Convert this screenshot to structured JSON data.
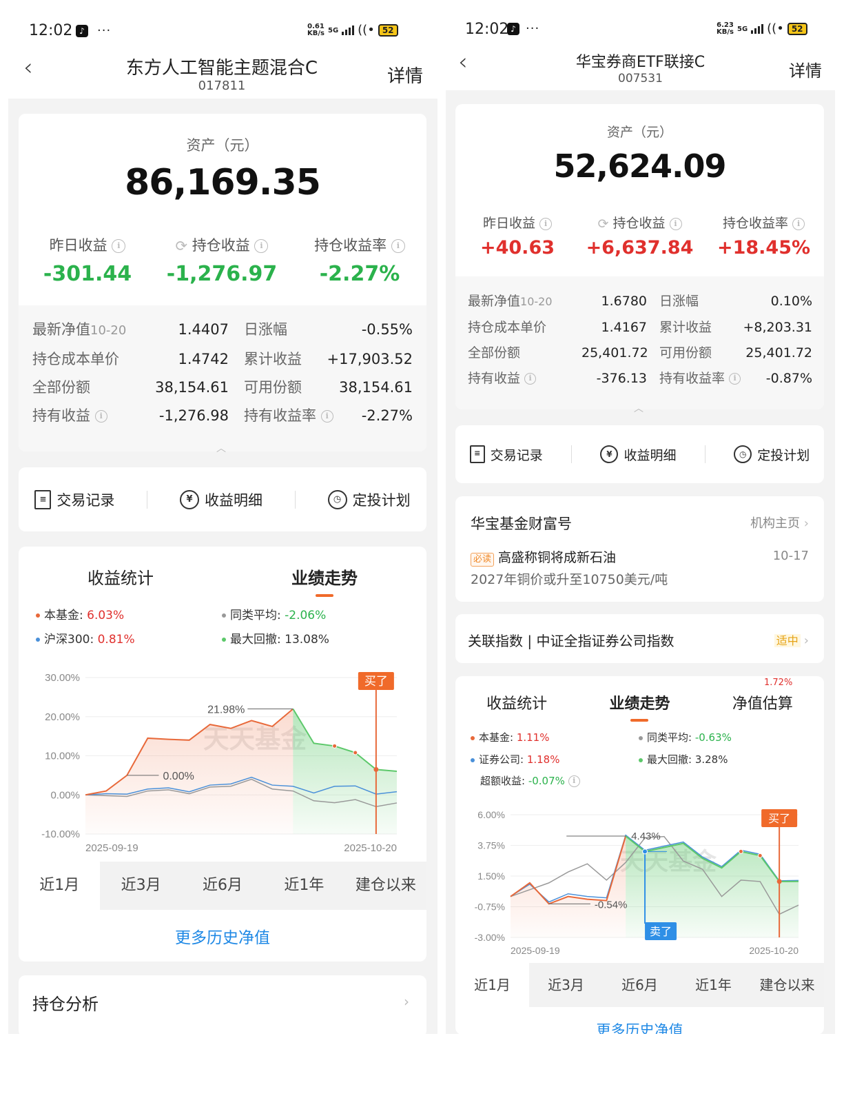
{
  "left": {
    "status": {
      "time": "12:02",
      "more": "···",
      "speed": "0.61\nKB/s",
      "net": "5G",
      "wifi": "((•",
      "battery": "52"
    },
    "header": {
      "back": "‹",
      "title": "东方人工智能主题混合C",
      "code": "017811",
      "detail": "详情"
    },
    "assets": {
      "label": "资产（元）",
      "value": "86,169.35",
      "metrics": [
        {
          "label": "昨日收益",
          "value": "-301.44"
        },
        {
          "label": "持仓收益",
          "value": "-1,276.97"
        },
        {
          "label": "持仓收益率",
          "value": "-2.27%"
        }
      ]
    },
    "details": {
      "nav_label": "最新净值",
      "nav_date": "10-20",
      "nav": "1.4407",
      "daily_label": "日涨幅",
      "daily": "-0.55%",
      "cost_label": "持仓成本单价",
      "cost": "1.4742",
      "cum_label": "累计收益",
      "cum": "+17,903.52",
      "shares_label": "全部份额",
      "shares": "38,154.61",
      "avail_label": "可用份额",
      "avail": "38,154.61",
      "hold_label": "持有收益",
      "hold": "-1,276.98",
      "hold_rate_label": "持有收益率",
      "hold_rate": "-2.27%"
    },
    "actions": [
      "交易记录",
      "收益明细",
      "定投计划"
    ],
    "tabs": [
      "收益统计",
      "业绩走势"
    ],
    "legend": {
      "fund": {
        "label": "本基金: ",
        "value": "6.03%"
      },
      "index": {
        "label": "沪深300: ",
        "value": "0.81%"
      },
      "peer": {
        "label": "同类平均: ",
        "value": "-2.06%"
      },
      "drawdown": {
        "label": "最大回撤: ",
        "value": "13.08%"
      }
    },
    "chart_data": {
      "type": "line",
      "x_start": "2025-09-19",
      "x_end": "2025-10-20",
      "ylim": [
        -10,
        30
      ],
      "yticks": [
        "30.00%",
        "20.00%",
        "10.00%",
        "0.00%",
        "-10.00%"
      ],
      "series": [
        {
          "name": "本基金",
          "color": "#e8693a",
          "values": [
            0,
            1,
            5,
            14.5,
            14.2,
            14,
            18,
            17,
            19,
            17.5,
            21.98,
            13.2,
            12.5,
            10.8,
            6.5,
            6.03
          ]
        },
        {
          "name": "沪深300",
          "color": "#4a90d9",
          "values": [
            0,
            0.3,
            0.2,
            1.5,
            1.8,
            0.8,
            2.5,
            2.8,
            4.5,
            2.5,
            2.2,
            0.5,
            2.2,
            2.3,
            0.2,
            0.81
          ]
        },
        {
          "name": "同类平均",
          "color": "#999999",
          "values": [
            0,
            -0.2,
            -0.4,
            1,
            1.3,
            0.3,
            2,
            2.2,
            4,
            1.5,
            1,
            -1.5,
            -2,
            -1.2,
            -3,
            -2.06
          ]
        }
      ],
      "annotations": {
        "max": "21.98%",
        "min": "0.00%",
        "buy": "买了"
      },
      "watermark": "天天基金"
    },
    "ranges": [
      "近1月",
      "近3月",
      "近6月",
      "近1年",
      "建仓以来"
    ],
    "more": "更多历史净值",
    "holdings": "持仓分析"
  },
  "right": {
    "status": {
      "time": "12:02",
      "more": "···",
      "speed": "6.23\nKB/s",
      "net": "5G",
      "wifi": "((•",
      "battery": "52"
    },
    "header": {
      "back": "‹",
      "title": "华宝券商ETF联接C",
      "code": "007531",
      "detail": "详情"
    },
    "assets": {
      "label": "资产（元）",
      "value": "52,624.09",
      "metrics": [
        {
          "label": "昨日收益",
          "value": "+40.63"
        },
        {
          "label": "持仓收益",
          "value": "+6,637.84"
        },
        {
          "label": "持仓收益率",
          "value": "+18.45%"
        }
      ]
    },
    "details": {
      "nav_label": "最新净值",
      "nav_date": "10-20",
      "nav": "1.6780",
      "daily_label": "日涨幅",
      "daily": "0.10%",
      "cost_label": "持仓成本单价",
      "cost": "1.4167",
      "cum_label": "累计收益",
      "cum": "+8,203.31",
      "shares_label": "全部份额",
      "shares": "25,401.72",
      "avail_label": "可用份额",
      "avail": "25,401.72",
      "hold_label": "持有收益",
      "hold": "-376.13",
      "hold_rate_label": "持有收益率",
      "hold_rate": "-0.87%"
    },
    "actions": [
      "交易记录",
      "收益明细",
      "定投计划"
    ],
    "news": {
      "source": "华宝基金财富号",
      "home": "机构主页",
      "badge": "必读",
      "headline": "高盛称铜将成新石油",
      "date": "10-17",
      "summary": "2027年铜价或升至10750美元/吨"
    },
    "index": {
      "label": "关联指数 | 中证全指证券公司指数",
      "rating": "适中"
    },
    "tabs": [
      "收益统计",
      "业绩走势",
      "净值估算"
    ],
    "estimate": "1.72%",
    "legend": {
      "fund": {
        "label": "本基金: ",
        "value": "1.11%"
      },
      "index": {
        "label": "证券公司: ",
        "value": "1.18%"
      },
      "excess": {
        "label": "超额收益: ",
        "value": "-0.07%"
      },
      "peer": {
        "label": "同类平均: ",
        "value": "-0.63%"
      },
      "drawdown": {
        "label": "最大回撤: ",
        "value": "3.28%"
      }
    },
    "chart_data": {
      "type": "line",
      "x_start": "2025-09-19",
      "x_end": "2025-10-20",
      "ylim": [
        -3,
        6
      ],
      "yticks": [
        "6.00%",
        "3.75%",
        "1.50%",
        "-0.75%",
        "-3.00%"
      ],
      "series": [
        {
          "name": "本基金",
          "color": "#e8693a",
          "values": [
            0,
            1,
            -0.54,
            0,
            -0.2,
            -0.3,
            4.43,
            3.3,
            3.6,
            3.9,
            2.8,
            2.1,
            3.3,
            3,
            1.1,
            1.11
          ]
        },
        {
          "name": "证券公司",
          "color": "#4a90d9",
          "values": [
            0,
            0.9,
            -0.4,
            0.2,
            0,
            -0.1,
            4.5,
            3.4,
            3.7,
            4,
            2.9,
            2.2,
            3.4,
            3.1,
            1.15,
            1.18
          ]
        },
        {
          "name": "同类平均",
          "color": "#999999",
          "values": [
            0,
            0.5,
            1,
            1.8,
            2.4,
            1.2,
            2.5,
            4.3,
            4.4,
            2.6,
            2,
            0,
            1.2,
            1.1,
            -1.3,
            -0.63
          ]
        }
      ],
      "annotations": {
        "max": "4.43%",
        "min": "-0.54%",
        "buy": "买了",
        "sell": "卖了"
      },
      "watermark": "天天基金"
    },
    "ranges": [
      "近1月",
      "近3月",
      "近6月",
      "近1年",
      "建仓以来"
    ],
    "more": "更多历史净值"
  }
}
